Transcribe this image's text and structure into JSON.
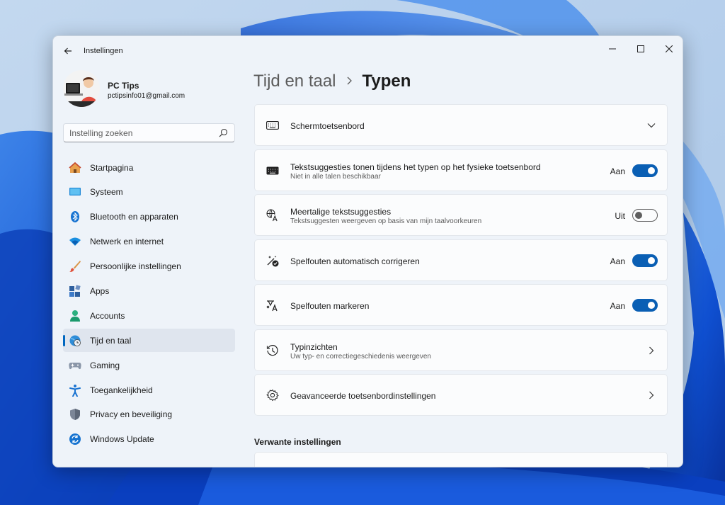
{
  "window": {
    "title": "Instellingen"
  },
  "profile": {
    "name": "PC Tips",
    "email": "pctipsinfo01@gmail.com"
  },
  "search": {
    "placeholder": "Instelling zoeken"
  },
  "nav": {
    "items": [
      {
        "label": "Startpagina",
        "icon": "home-icon"
      },
      {
        "label": "Systeem",
        "icon": "monitor-icon"
      },
      {
        "label": "Bluetooth en apparaten",
        "icon": "bluetooth-icon"
      },
      {
        "label": "Netwerk en internet",
        "icon": "wifi-icon"
      },
      {
        "label": "Persoonlijke instellingen",
        "icon": "brush-icon"
      },
      {
        "label": "Apps",
        "icon": "apps-icon"
      },
      {
        "label": "Accounts",
        "icon": "person-icon"
      },
      {
        "label": "Tijd en taal",
        "icon": "globe-clock-icon",
        "selected": true
      },
      {
        "label": "Gaming",
        "icon": "gamepad-icon"
      },
      {
        "label": "Toegankelijkheid",
        "icon": "accessibility-icon"
      },
      {
        "label": "Privacy en beveiliging",
        "icon": "shield-icon"
      },
      {
        "label": "Windows Update",
        "icon": "update-icon"
      }
    ]
  },
  "breadcrumb": {
    "parent": "Tijd en taal",
    "current": "Typen"
  },
  "settings": [
    {
      "title": "Schermtoetsenbord",
      "control": "expand",
      "icon": "keyboard-icon"
    },
    {
      "title": "Tekstsuggesties tonen tijdens het typen op het fysieke toetsenbord",
      "subtitle": "Niet in alle talen beschikbaar",
      "state_label": "Aan",
      "on": true,
      "icon": "keyboard-solid-icon"
    },
    {
      "title": "Meertalige tekstsuggesties",
      "subtitle": "Tekstsuggesten weergeven op basis van mijn taalvoorkeuren",
      "state_label": "Uit",
      "on": false,
      "icon": "translate-icon"
    },
    {
      "title": "Spelfouten automatisch corrigeren",
      "state_label": "Aan",
      "on": true,
      "icon": "autocorrect-icon"
    },
    {
      "title": "Spelfouten markeren",
      "state_label": "Aan",
      "on": true,
      "icon": "spellcheck-icon"
    },
    {
      "title": "Typinzichten",
      "subtitle": "Uw typ- en correctiegeschiedenis weergeven",
      "control": "navigate",
      "icon": "history-icon"
    },
    {
      "title": "Geavanceerde toetsenbordinstellingen",
      "control": "navigate",
      "icon": "gear-icon"
    }
  ],
  "related": {
    "title": "Verwante instellingen"
  },
  "colors": {
    "accent": "#0a5fb4",
    "window_bg": "#eef3f9",
    "card_bg": "#fbfcfd"
  }
}
